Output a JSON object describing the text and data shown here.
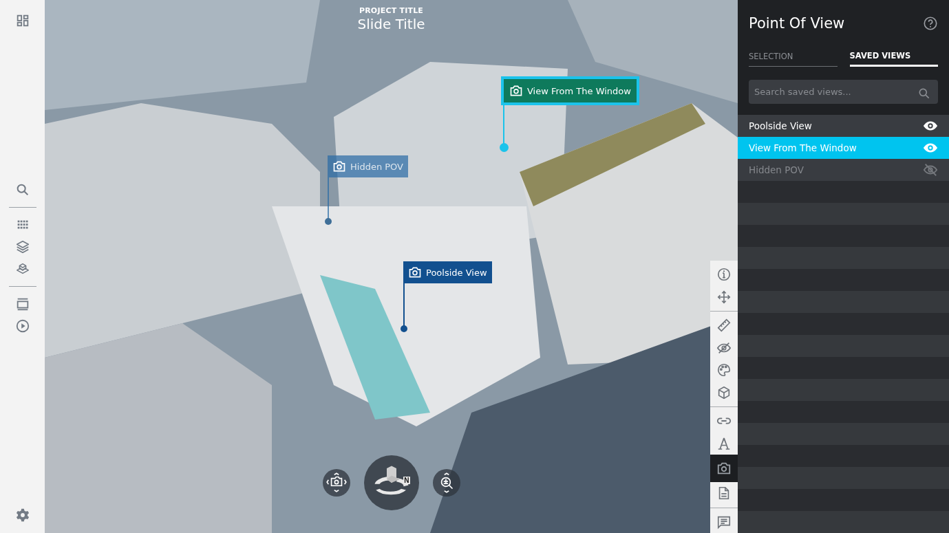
{
  "sidebar": {
    "groups": [
      [
        {
          "kind": "dashboard"
        }
      ],
      [
        {
          "kind": "search"
        }
      ],
      [
        {
          "kind": "grid"
        },
        {
          "kind": "layers"
        },
        {
          "kind": "stack"
        }
      ],
      [
        {
          "kind": "slides"
        },
        {
          "kind": "play"
        }
      ],
      [
        {
          "kind": "settings"
        }
      ]
    ]
  },
  "viewport": {
    "project_title": "PROJECT TITLE",
    "slide_title": "Slide Title",
    "markers": [
      {
        "label": "View From The Window",
        "selected": true,
        "hidden": false
      },
      {
        "label": "Hidden POV",
        "selected": false,
        "hidden": true
      },
      {
        "label": "Poolside View",
        "selected": false,
        "hidden": false
      }
    ],
    "compass_letter": "N",
    "toolbar": [
      [
        {
          "kind": "info",
          "selected": false
        },
        {
          "kind": "move",
          "selected": false
        }
      ],
      [
        {
          "kind": "ruler",
          "selected": false
        },
        {
          "kind": "hide",
          "selected": false
        },
        {
          "kind": "palette",
          "selected": false
        },
        {
          "kind": "cube",
          "selected": false
        }
      ],
      [
        {
          "kind": "link",
          "selected": false
        },
        {
          "kind": "text",
          "selected": false
        },
        {
          "kind": "camera",
          "selected": true
        },
        {
          "kind": "document",
          "selected": false
        }
      ],
      [
        {
          "kind": "comment",
          "selected": false
        }
      ]
    ]
  },
  "panel": {
    "title": "Point Of View",
    "tabs": [
      {
        "label": "SELECTION",
        "selected": false
      },
      {
        "label": "SAVED VIEWS",
        "selected": true
      }
    ],
    "search": {
      "placeholder": "Search saved views..."
    },
    "saved_views": [
      {
        "label": "Poolside View",
        "selected": false,
        "visible": true
      },
      {
        "label": "View From The Window",
        "selected": true,
        "visible": true
      },
      {
        "label": "Hidden POV",
        "selected": false,
        "visible": false
      }
    ]
  }
}
